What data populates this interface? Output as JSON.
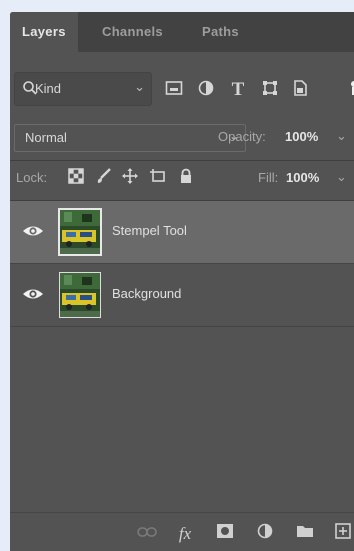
{
  "tabs": [
    {
      "label": "Layers",
      "active": true
    },
    {
      "label": "Channels",
      "active": false
    },
    {
      "label": "Paths",
      "active": false
    }
  ],
  "filter": {
    "kind_label": "Kind",
    "icons": [
      "pixel-filter-icon",
      "adjustment-filter-icon",
      "type-filter-icon",
      "shape-filter-icon",
      "smart-object-filter-icon"
    ]
  },
  "blend": {
    "mode": "Normal",
    "opacity_label": "Opacity:",
    "opacity_value": "100%"
  },
  "lock": {
    "label": "Lock:",
    "fill_label": "Fill:",
    "fill_value": "100%"
  },
  "layers": [
    {
      "name": "Stempel Tool",
      "visible": true,
      "selected": true
    },
    {
      "name": "Background",
      "visible": true,
      "selected": false
    }
  ],
  "colors": {
    "panel_bg": "#535353",
    "tab_bar_bg": "#424242",
    "selected_layer_bg": "#6a6a6a",
    "page_bg": "#e7edf8"
  }
}
